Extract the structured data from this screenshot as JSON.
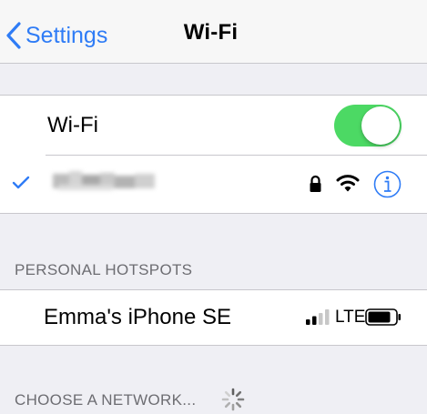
{
  "navbar": {
    "back_label": "Settings",
    "title": "Wi-Fi"
  },
  "wifi": {
    "label": "Wi-Fi",
    "enabled": true,
    "toggle_color": "#4cd964"
  },
  "connected_network": {
    "name_obscured": true,
    "icons": [
      "checkmark-icon",
      "lock-icon",
      "wifi-signal-icon",
      "info-icon"
    ]
  },
  "personal_hotspots": {
    "header": "PERSONAL HOTSPOTS",
    "items": [
      {
        "name": "Emma's iPhone SE",
        "network_type": "LTE",
        "signal_bars": 2,
        "signal_bars_total": 4,
        "battery_level": 0.8
      }
    ]
  },
  "choose_network": {
    "header": "CHOOSE A NETWORK...",
    "loading": true
  },
  "colors": {
    "accent": "#2f7cf6",
    "background": "#efeff4",
    "header_text": "#6d6d72",
    "separator": "#c8c7cc"
  }
}
